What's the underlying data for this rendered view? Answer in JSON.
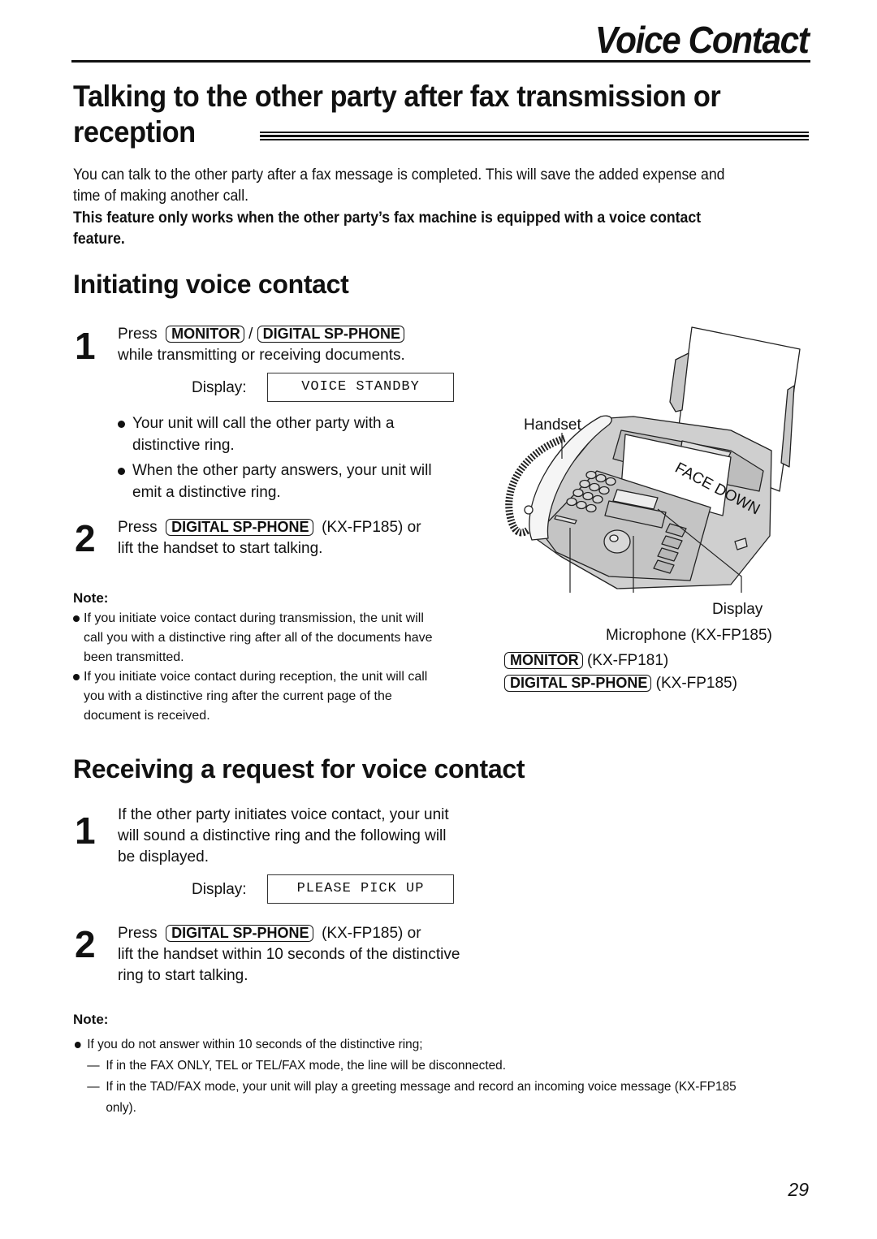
{
  "header": {
    "title": "Voice Contact"
  },
  "section_main": {
    "title": "Talking to the other party after fax transmission or reception",
    "intro": "You can talk to the other party after a fax message is completed. This will save the added expense and time of making another call.",
    "intro_bold": "This feature only works when the other party’s fax machine is equipped with a voice contact feature."
  },
  "initiating": {
    "title": "Initiating voice contact",
    "step1": {
      "number": "1",
      "press": "Press",
      "key1": "MONITOR",
      "separator": "/",
      "key2": "DIGITAL SP-PHONE",
      "text": "while transmitting or receiving documents.",
      "display_label": "Display:",
      "display_value": "VOICE STANDBY",
      "bullets": [
        "Your unit will call the other party with a distinctive ring.",
        "When the other party answers, your unit will emit a distinctive ring."
      ]
    },
    "step2": {
      "number": "2",
      "press": "Press",
      "key": "DIGITAL SP-PHONE",
      "model_suffix": "(KX-FP185) or",
      "text": "lift the handset to start talking."
    },
    "note": {
      "label": "Note:",
      "items": [
        "If you initiate voice contact during transmission, the unit will call you with a distinctive ring after all of the documents have been transmitted.",
        "If you initiate voice contact during reception, the unit will call you with a distinctive ring after the current page of the document is received."
      ]
    }
  },
  "illustration": {
    "paper_text": "FACE DOWN",
    "callouts": {
      "handset": "Handset",
      "display": "Display",
      "microphone": "Microphone (KX-FP185)",
      "monitor_key": "MONITOR",
      "monitor_model": "(KX-FP181)",
      "sp_phone_key": "DIGITAL SP-PHONE",
      "sp_phone_model": "(KX-FP185)"
    }
  },
  "receiving": {
    "title": "Receiving a request for voice contact",
    "step1": {
      "number": "1",
      "text": "If the other party initiates voice contact, your unit will sound a distinctive ring and the following will be displayed.",
      "display_label": "Display:",
      "display_value": "PLEASE PICK UP"
    },
    "step2": {
      "number": "2",
      "press": "Press",
      "key": "DIGITAL SP-PHONE",
      "model_suffix": "(KX-FP185) or",
      "text": "lift the handset within 10 seconds of the distinctive ring to start talking."
    },
    "note": {
      "label": "Note:",
      "bullet": "If you do not answer within 10 seconds of the distinctive ring;",
      "dashes": [
        "If in the FAX ONLY, TEL or TEL/FAX mode, the line will be disconnected.",
        "If in the TAD/FAX mode, your unit will play a greeting message and record an incoming voice message (KX-FP185 only)."
      ],
      "dash_glyph": "—"
    }
  },
  "footer": {
    "page_number": "29"
  }
}
